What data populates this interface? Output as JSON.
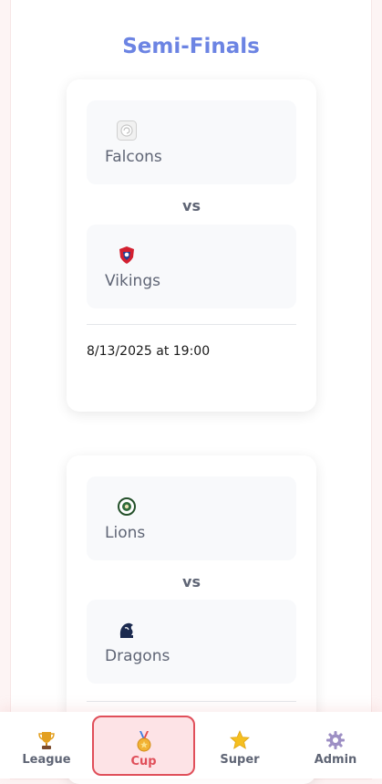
{
  "page": {
    "title": "Semi-Finals"
  },
  "matches": [
    {
      "home": {
        "name": "Falcons",
        "logo": "falcons-logo-icon"
      },
      "away": {
        "name": "Vikings",
        "logo": "vikings-logo-icon"
      },
      "vs": "vs",
      "datetime": "8/13/2025 at 19:00"
    },
    {
      "home": {
        "name": "Lions",
        "logo": "lions-logo-icon"
      },
      "away": {
        "name": "Dragons",
        "logo": "dragons-logo-icon"
      },
      "vs": "vs"
    }
  ],
  "nav": {
    "items": [
      {
        "label": "League",
        "icon": "trophy-icon"
      },
      {
        "label": "Cup",
        "icon": "medal-icon",
        "active": true
      },
      {
        "label": "Super",
        "icon": "star-icon"
      },
      {
        "label": "Admin",
        "icon": "gear-icon"
      }
    ]
  },
  "colors": {
    "accent": "#6c84e3",
    "active": "#e04f5a",
    "active_bg": "#fde3e6"
  }
}
